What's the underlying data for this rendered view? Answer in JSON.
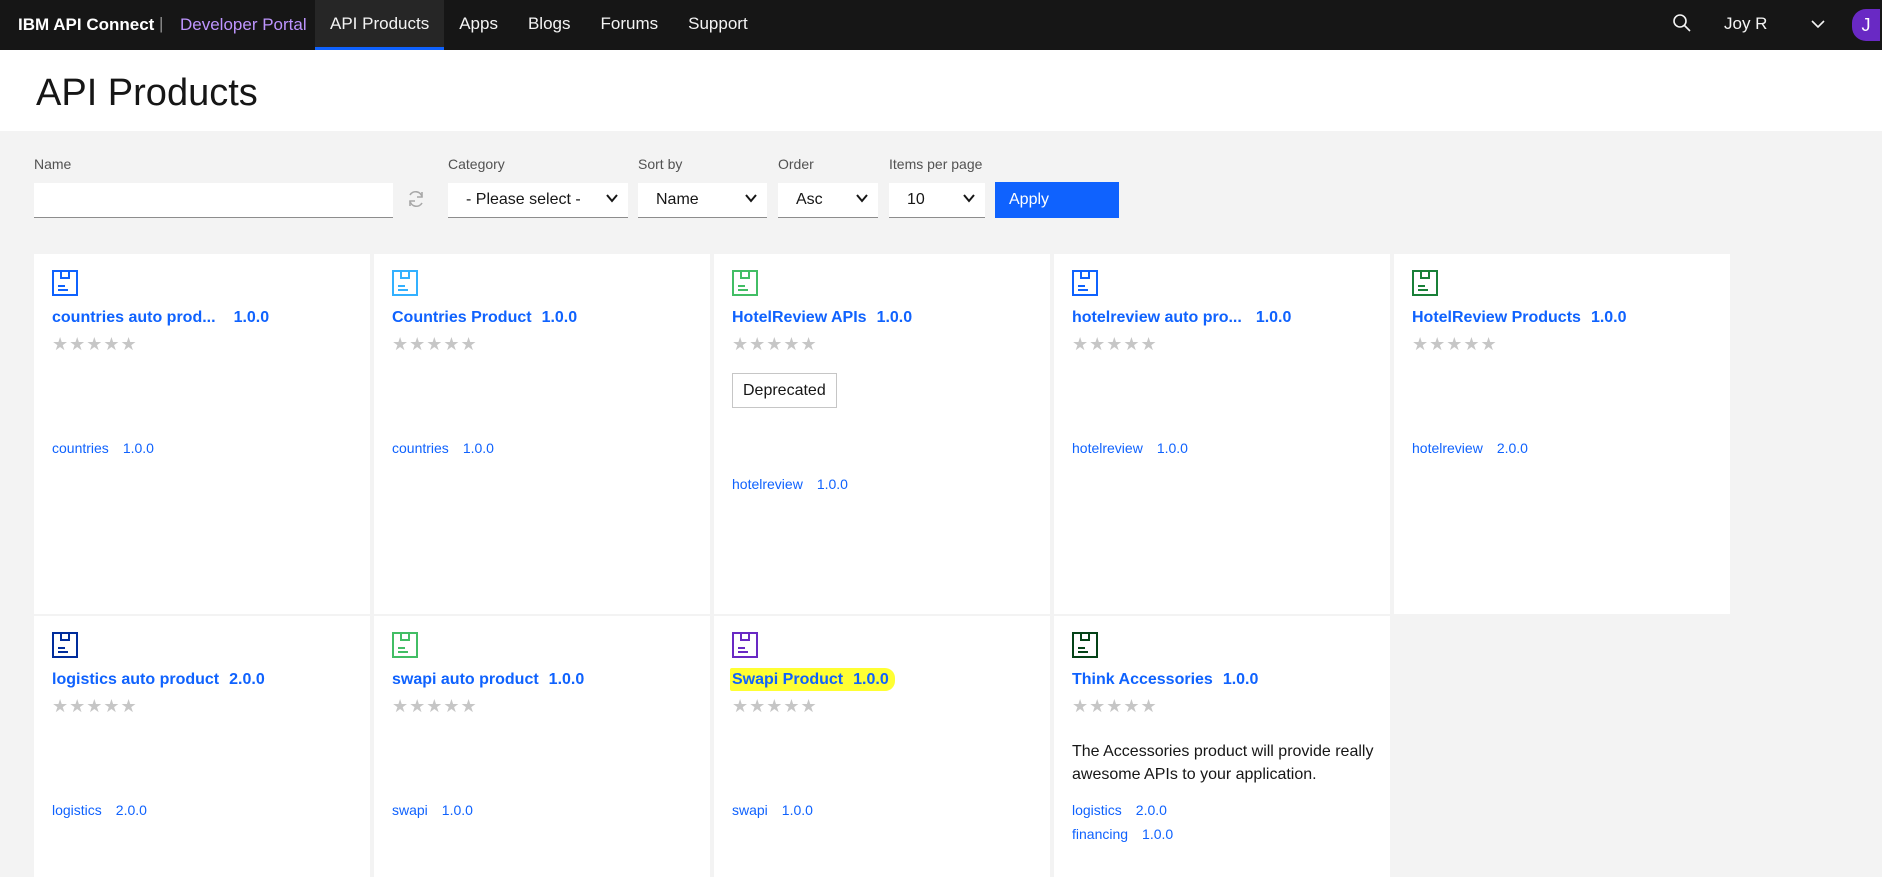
{
  "topnav": {
    "brand": "IBM API Connect",
    "separator": "|",
    "portal": "Developer Portal",
    "links": [
      "API Products",
      "Apps",
      "Blogs",
      "Forums",
      "Support"
    ],
    "active_link": "API Products",
    "user_name": "Joy R",
    "avatar_initial": "J",
    "icons": {
      "search": "search-icon",
      "user_menu": "chevron-down-icon"
    }
  },
  "page": {
    "title": "API Products"
  },
  "filters": {
    "name_label": "Name",
    "name_value": "",
    "category_label": "Category",
    "category_value": "- Please select -",
    "sort_label": "Sort by",
    "sort_value": "Name",
    "order_label": "Order",
    "order_value": "Asc",
    "items_label": "Items per page",
    "items_value": "10",
    "apply_label": "Apply"
  },
  "products": [
    {
      "name": "countries auto prod...",
      "version": "1.0.0",
      "icon_color": "#0f62fe",
      "rating": 0,
      "apis": [
        {
          "name": "countries",
          "version": "1.0.0"
        }
      ]
    },
    {
      "name": "Countries Product",
      "version": "1.0.0",
      "icon_color": "#33b1ff",
      "rating": 0,
      "apis": [
        {
          "name": "countries",
          "version": "1.0.0"
        }
      ]
    },
    {
      "name": "HotelReview APIs",
      "version": "1.0.0",
      "icon_color": "#42be65",
      "rating": 0,
      "badge": "Deprecated",
      "apis": [
        {
          "name": "hotelreview",
          "version": "1.0.0"
        }
      ]
    },
    {
      "name": "hotelreview auto pro...",
      "version": "1.0.0",
      "icon_color": "#0f62fe",
      "rating": 0,
      "apis": [
        {
          "name": "hotelreview",
          "version": "1.0.0"
        }
      ]
    },
    {
      "name": "HotelReview Products",
      "version": "1.0.0",
      "icon_color": "#198038",
      "rating": 0,
      "apis": [
        {
          "name": "hotelreview",
          "version": "2.0.0"
        }
      ]
    },
    {
      "name": "logistics auto product",
      "version": "2.0.0",
      "icon_color": "#002d9c",
      "rating": 0,
      "apis": [
        {
          "name": "logistics",
          "version": "2.0.0"
        }
      ]
    },
    {
      "name": "swapi auto product",
      "version": "1.0.0",
      "icon_color": "#42be65",
      "rating": 0,
      "apis": [
        {
          "name": "swapi",
          "version": "1.0.0"
        }
      ]
    },
    {
      "name": "Swapi Product",
      "version": "1.0.0",
      "icon_color": "#6929c4",
      "rating": 0,
      "highlighted": true,
      "apis": [
        {
          "name": "swapi",
          "version": "1.0.0"
        }
      ]
    },
    {
      "name": "Think Accessories",
      "version": "1.0.0",
      "icon_color": "#044317",
      "rating": 0,
      "description": "The Accessories product will provide really awesome APIs to your application.",
      "apis": [
        {
          "name": "logistics",
          "version": "2.0.0"
        },
        {
          "name": "financing",
          "version": "1.0.0"
        }
      ]
    }
  ],
  "stars_text": "★★★★★",
  "highlight_color": "#ffff33",
  "accent_color": "#0f62fe"
}
